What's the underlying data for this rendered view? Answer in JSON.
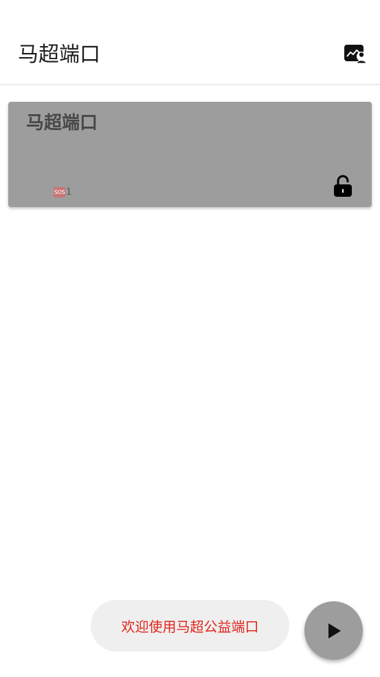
{
  "appbar": {
    "title": "马超端口",
    "action_icon": "image-person-icon"
  },
  "card": {
    "title": "马超端口",
    "sos_badge": "SOS",
    "sos_count": "1",
    "lock_icon": "lock-open-icon",
    "background_color": "#9e9d9d"
  },
  "toast": {
    "message": "欢迎使用马超公益端口",
    "text_color": "#e0251b"
  },
  "fab": {
    "icon": "play-icon"
  }
}
